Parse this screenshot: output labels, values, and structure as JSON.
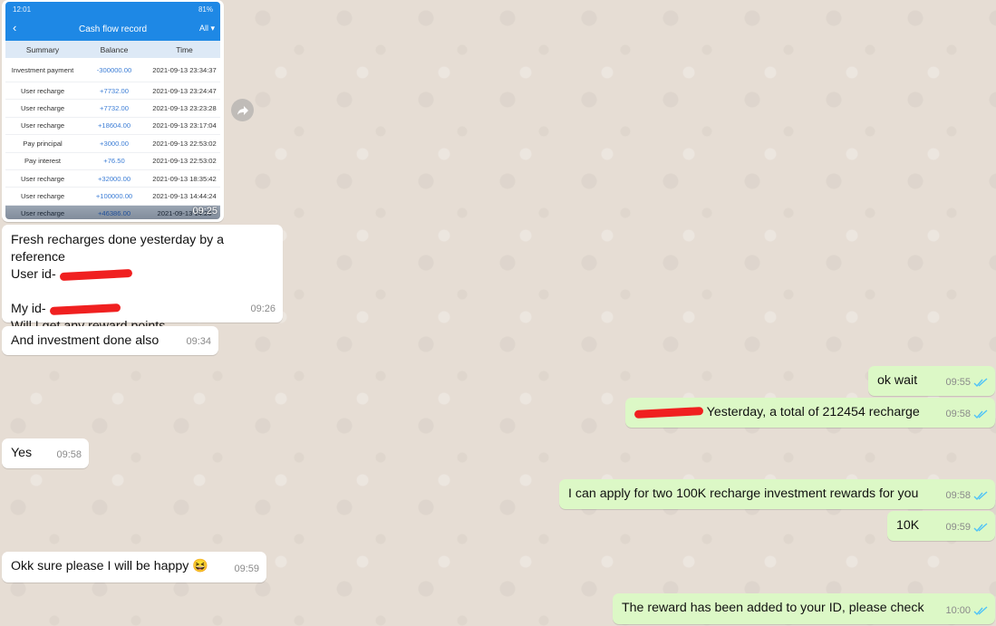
{
  "cash_flow": {
    "status_time": "12:01",
    "status_battery": "81%",
    "title": "Cash flow record",
    "filter": "All",
    "columns": [
      "Summary",
      "Balance",
      "Time"
    ],
    "rows": [
      {
        "summary": "Investment payment",
        "balance": "-300000.00",
        "time": "2021-09-13 23:34:37"
      },
      {
        "summary": "User recharge",
        "balance": "+7732.00",
        "time": "2021-09-13 23:24:47"
      },
      {
        "summary": "User recharge",
        "balance": "+7732.00",
        "time": "2021-09-13 23:23:28"
      },
      {
        "summary": "User recharge",
        "balance": "+18604.00",
        "time": "2021-09-13 23:17:04"
      },
      {
        "summary": "Pay principal",
        "balance": "+3000.00",
        "time": "2021-09-13 22:53:02"
      },
      {
        "summary": "Pay interest",
        "balance": "+76.50",
        "time": "2021-09-13 22:53:02"
      },
      {
        "summary": "User recharge",
        "balance": "+32000.00",
        "time": "2021-09-13 18:35:42"
      },
      {
        "summary": "User recharge",
        "balance": "+100000.00",
        "time": "2021-09-13 14:44:24"
      },
      {
        "summary": "User recharge",
        "balance": "+46386.00",
        "time": "2021-09-13 14:26"
      }
    ],
    "image_time": "09:25"
  },
  "messages": {
    "m1": {
      "line1": "Fresh recharges done yesterday by a reference",
      "line2": "User id- ",
      "line3": "My id- ",
      "line4": "Will I get any reward points",
      "time": "09:26"
    },
    "m2": {
      "text": "And investment done also",
      "time": "09:34"
    },
    "m3": {
      "text": "ok wait",
      "time": "09:55"
    },
    "m4": {
      "text": " Yesterday, a total of 212454 recharge",
      "time": "09:58"
    },
    "m5": {
      "text": "Yes",
      "time": "09:58"
    },
    "m6": {
      "text": "I can apply for two 100K recharge investment rewards for you",
      "time": "09:58"
    },
    "m7": {
      "text": "10K",
      "time": "09:59"
    },
    "m8": {
      "text": "Okk sure please I will be happy",
      "emoji": "😆",
      "time": "09:59"
    },
    "m9": {
      "text": "The reward has been added to your ID, please check",
      "time": "10:00"
    }
  },
  "colors": {
    "incoming": "#ffffff",
    "outgoing": "#dcf8c6",
    "read_ticks": "#4fc3f7",
    "wallpaper": "#e6ddd4"
  }
}
